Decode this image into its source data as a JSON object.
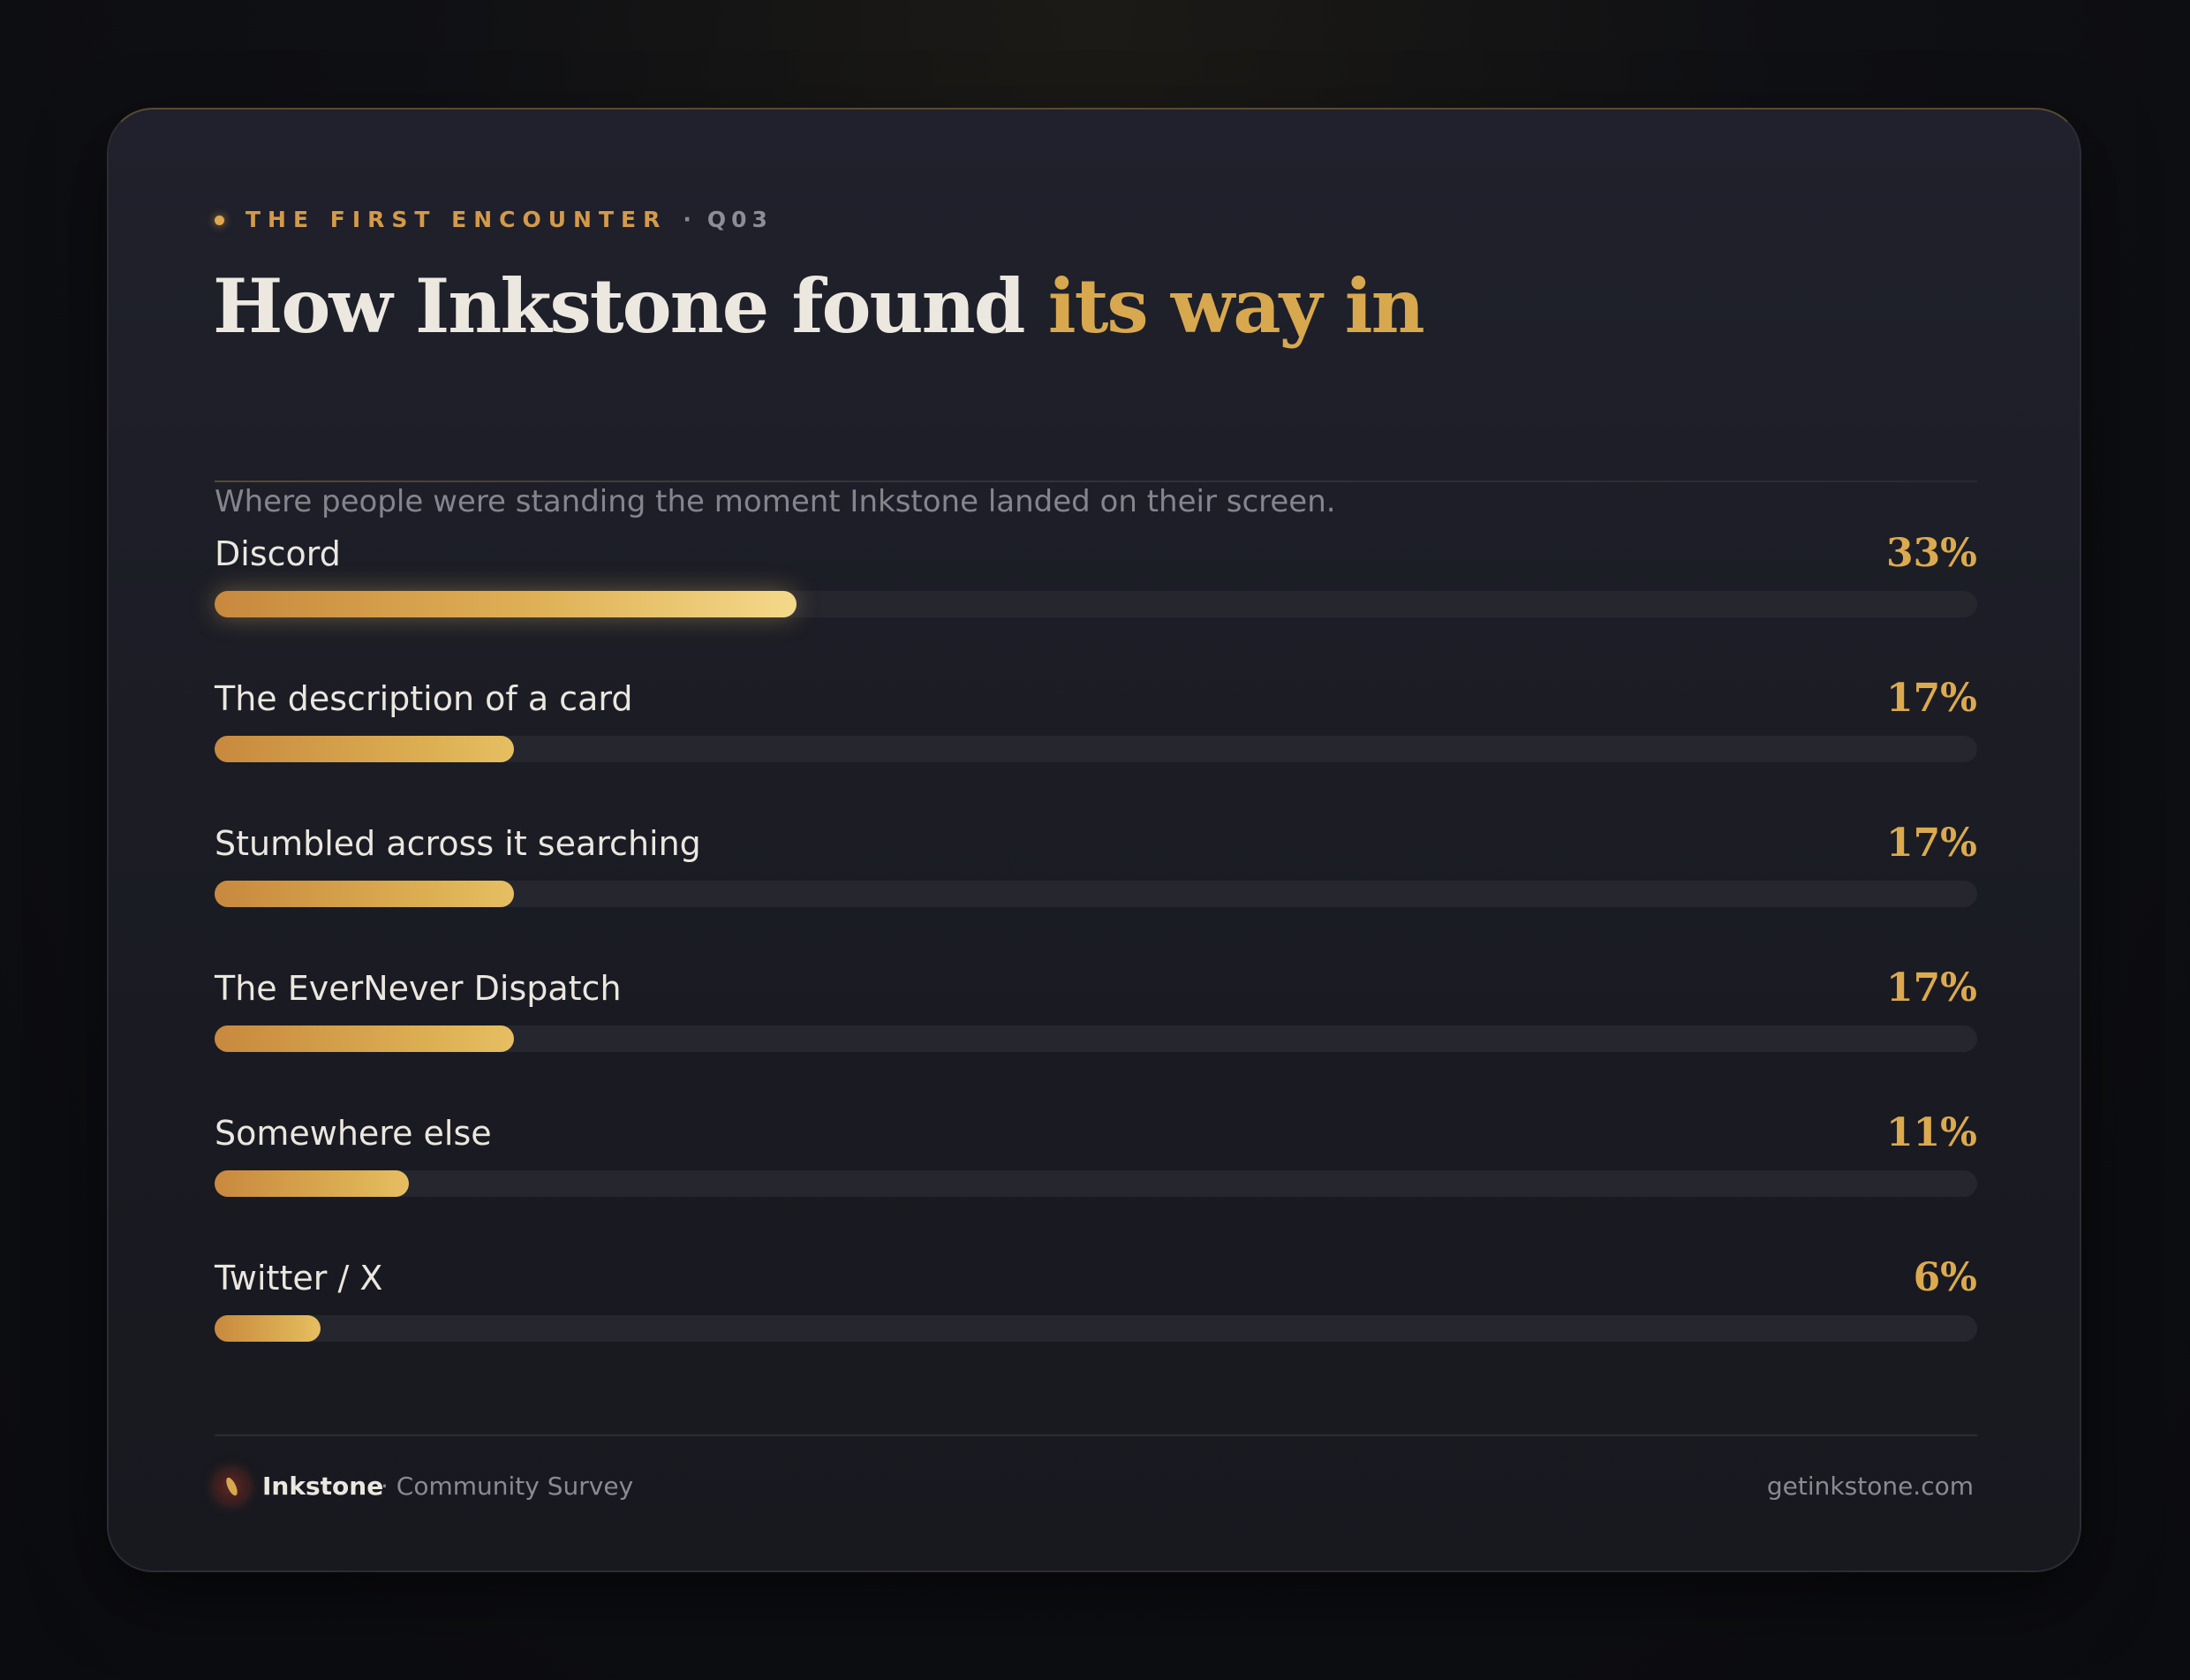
{
  "eyebrow": {
    "kicker": "THE FIRST ENCOUNTER",
    "separator": "·",
    "question": "Q03"
  },
  "title": {
    "main": "How Inkstone found ",
    "accent": "its way in"
  },
  "subtitle": "Where people were standing the moment Inkstone landed on their screen.",
  "colors": {
    "accent": "#d8a84e",
    "background": "#1b1c24",
    "track": "#25262e"
  },
  "chart_data": {
    "type": "bar",
    "orientation": "horizontal",
    "categories": [
      "Discord",
      "The description of a card",
      "Stumbled across it searching",
      "The EverNever Dispatch",
      "Somewhere else",
      "Twitter / X"
    ],
    "values": [
      33,
      17,
      17,
      17,
      11,
      6
    ],
    "value_labels": [
      "33%",
      "17%",
      "17%",
      "17%",
      "11%",
      "6%"
    ],
    "xlim": [
      0,
      100
    ],
    "grid": false,
    "legend": "none"
  },
  "footer": {
    "brand": "Inkstone",
    "subtitle": "· Community Survey",
    "url": "getinkstone.com",
    "logo_icon": "ink-drop-icon"
  }
}
